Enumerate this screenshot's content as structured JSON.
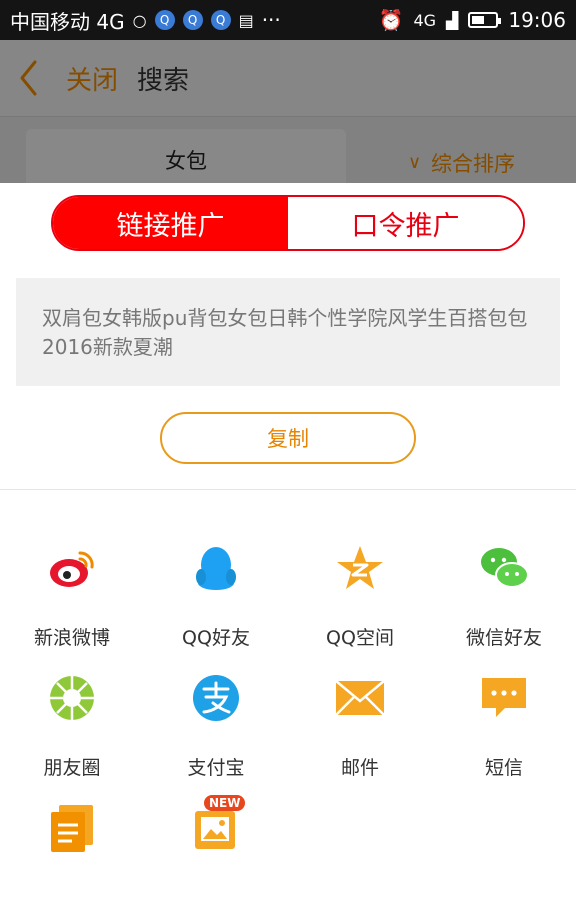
{
  "status_bar": {
    "carrier": "中国移动 4G",
    "signal_label": "4G",
    "time": "19:06"
  },
  "header": {
    "close_label": "关闭",
    "title": "搜索"
  },
  "filter_bar": {
    "keyword": "女包",
    "sort_label": "综合排序"
  },
  "share_sheet": {
    "tabs": [
      {
        "label": "链接推广",
        "active": true
      },
      {
        "label": "口令推广",
        "active": false
      }
    ],
    "product_text": "双肩包女韩版pu背包女包日韩个性学院风学生百搭包包2016新款夏潮",
    "copy_label": "复制",
    "targets": [
      {
        "label": "新浪微博",
        "icon": "weibo-icon"
      },
      {
        "label": "QQ好友",
        "icon": "qq-icon"
      },
      {
        "label": "QQ空间",
        "icon": "qzone-icon"
      },
      {
        "label": "微信好友",
        "icon": "wechat-icon"
      },
      {
        "label": "朋友圈",
        "icon": "moments-icon"
      },
      {
        "label": "支付宝",
        "icon": "alipay-icon"
      },
      {
        "label": "邮件",
        "icon": "email-icon"
      },
      {
        "label": "短信",
        "icon": "sms-icon"
      },
      {
        "label": "",
        "icon": "copy-link-icon"
      },
      {
        "label": "",
        "icon": "image-share-icon",
        "badge": "NEW"
      }
    ]
  },
  "colors": {
    "accent_orange": "#f18d00",
    "primary_red": "#ff0000",
    "text_gray": "#777777"
  }
}
